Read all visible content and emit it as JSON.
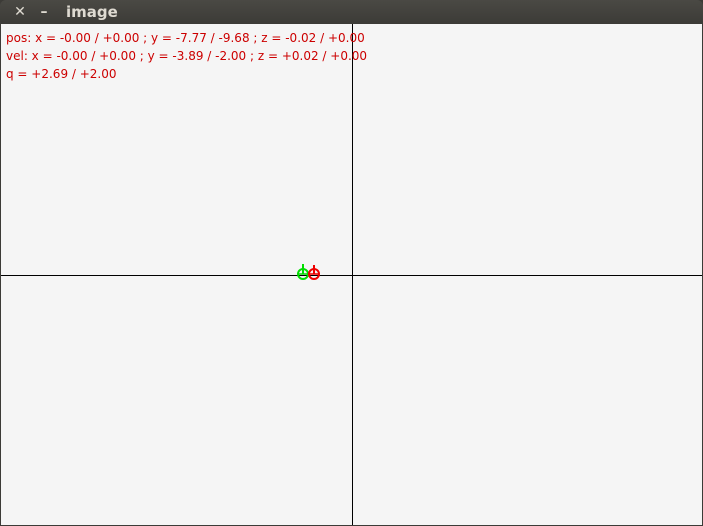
{
  "window": {
    "title": "image",
    "close_icon": "close-icon",
    "minimize_icon": "minimize-icon"
  },
  "hud": {
    "pos_text": "pos: x = -0.00 / +0.00 ; y = -7.77 / -9.68 ; z = -0.02 / +0.00",
    "vel_text": "vel: x = -0.00 / +0.00 ; y = -3.89 / -2.00 ; z = +0.02 / +0.00",
    "q_text": "q = +2.69 / +2.00",
    "color": "#cc0000"
  },
  "markers": {
    "estimate_color": "#00dd00",
    "target_color": "#ee0000"
  },
  "colors": {
    "background": "#f5f5f5",
    "axes": "#000000"
  }
}
